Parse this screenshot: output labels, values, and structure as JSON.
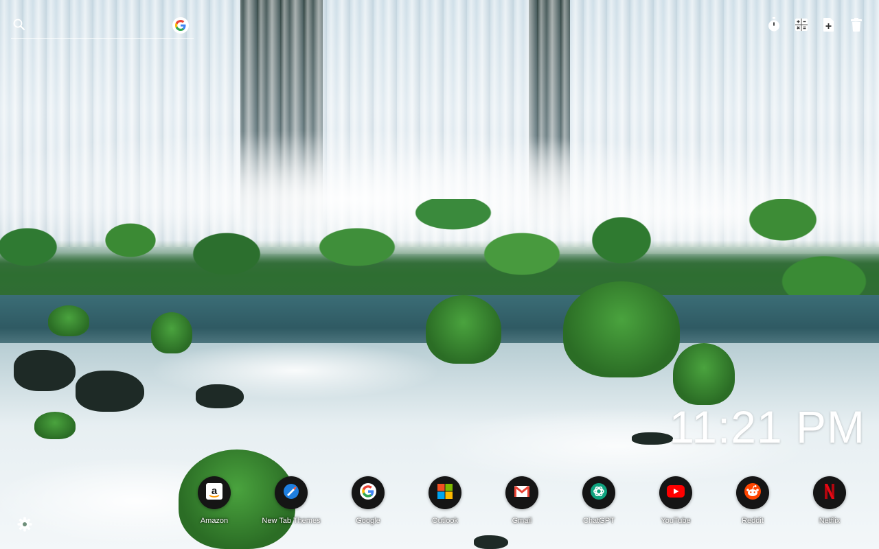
{
  "search": {
    "placeholder": "",
    "icon": "search-icon",
    "engine_icon": "google-icon"
  },
  "toolbar": {
    "items": [
      {
        "icon": "timer-icon"
      },
      {
        "icon": "calculator-icon"
      },
      {
        "icon": "add-note-icon"
      },
      {
        "icon": "trash-icon"
      }
    ]
  },
  "clock": {
    "time": "11:21 PM"
  },
  "shortcuts": [
    {
      "label": "Amazon",
      "icon": "amazon-icon"
    },
    {
      "label": "New Tab Themes",
      "icon": "new-tab-themes-icon"
    },
    {
      "label": "Google",
      "icon": "google-icon"
    },
    {
      "label": "Outlook",
      "icon": "microsoft-icon"
    },
    {
      "label": "Gmail",
      "icon": "gmail-icon"
    },
    {
      "label": "ChatGPT",
      "icon": "chatgpt-icon"
    },
    {
      "label": "YouTube",
      "icon": "youtube-icon"
    },
    {
      "label": "Reddit",
      "icon": "reddit-icon"
    },
    {
      "label": "Netflix",
      "icon": "netflix-icon"
    }
  ],
  "settings": {
    "icon": "gear-icon"
  },
  "colors": {
    "shortcut_bg": "#151515",
    "text": "#ffffff",
    "youtube": "#ff0000",
    "netflix": "#e50914",
    "reddit": "#ff4500",
    "microsoft": [
      "#f25022",
      "#7fba00",
      "#00a4ef",
      "#ffb900"
    ],
    "google": [
      "#4285f4",
      "#ea4335",
      "#fbbc05",
      "#34a853"
    ]
  }
}
